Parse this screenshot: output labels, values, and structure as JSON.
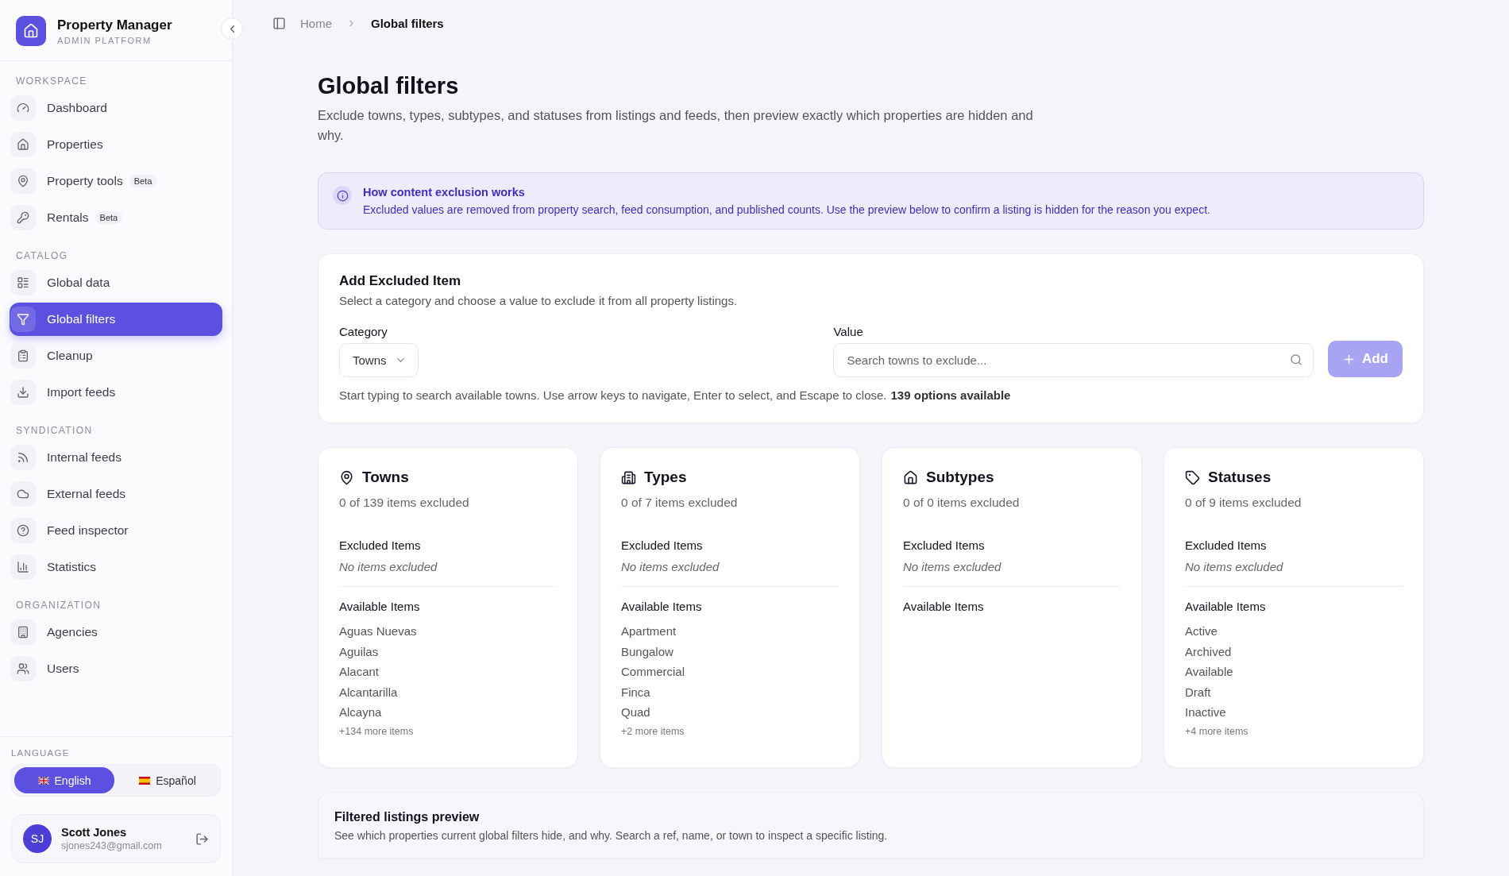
{
  "app": {
    "name": "Property Manager",
    "subtitle": "ADMIN PLATFORM"
  },
  "sidebar": {
    "sections": [
      {
        "label": "WORKSPACE",
        "items": [
          {
            "label": "Dashboard",
            "selected": false
          },
          {
            "label": "Properties",
            "selected": false
          },
          {
            "label": "Property tools",
            "badge": "Beta",
            "selected": false
          },
          {
            "label": "Rentals",
            "badge": "Beta",
            "selected": false
          }
        ]
      },
      {
        "label": "CATALOG",
        "items": [
          {
            "label": "Global data",
            "selected": false
          },
          {
            "label": "Global filters",
            "selected": true
          },
          {
            "label": "Cleanup",
            "selected": false
          },
          {
            "label": "Import feeds",
            "selected": false
          }
        ]
      },
      {
        "label": "SYNDICATION",
        "items": [
          {
            "label": "Internal feeds",
            "selected": false
          },
          {
            "label": "External feeds",
            "selected": false
          },
          {
            "label": "Feed inspector",
            "selected": false
          },
          {
            "label": "Statistics",
            "selected": false
          }
        ]
      },
      {
        "label": "ORGANIZATION",
        "items": [
          {
            "label": "Agencies",
            "selected": false
          },
          {
            "label": "Users",
            "selected": false
          }
        ]
      }
    ]
  },
  "language": {
    "label": "LANGUAGE",
    "options": [
      {
        "label": "English",
        "selected": true
      },
      {
        "label": "Español",
        "selected": false
      }
    ]
  },
  "user": {
    "initials": "SJ",
    "name": "Scott Jones",
    "email": "sjones243@gmail.com"
  },
  "breadcrumb": [
    "Home",
    "Global filters"
  ],
  "page": {
    "title": "Global filters",
    "description": "Exclude towns, types, subtypes, and statuses from listings and feeds, then preview exactly which properties are hidden and why."
  },
  "info": {
    "title": "How content exclusion works",
    "text": "Excluded values are removed from property search, feed consumption, and published counts. Use the preview below to confirm a listing is hidden for the reason you expect."
  },
  "add_form": {
    "title": "Add Excluded Item",
    "description": "Select a category and choose a value to exclude it from all property listings.",
    "category": {
      "label": "Category",
      "value": "Towns"
    },
    "value": {
      "label": "Value",
      "placeholder": "Search towns to exclude..."
    },
    "button": {
      "label": "Add",
      "disabled": true
    },
    "hint": "Start typing to search available towns. Use arrow keys to navigate, Enter to select, and Escape to close.",
    "options_count": "139 options available"
  },
  "cards": [
    {
      "title": "Towns",
      "count": "0 of 139 items excluded",
      "excluded_label": "Excluded Items",
      "excluded_empty": "No items excluded",
      "available_label": "Available Items",
      "items": [
        "Aguas Nuevas",
        "Aguilas",
        "Alacant",
        "Alcantarilla",
        "Alcayna"
      ],
      "more": "+134 more items"
    },
    {
      "title": "Types",
      "count": "0 of 7 items excluded",
      "excluded_label": "Excluded Items",
      "excluded_empty": "No items excluded",
      "available_label": "Available Items",
      "items": [
        "Apartment",
        "Bungalow",
        "Commercial",
        "Finca",
        "Quad"
      ],
      "more": "+2 more items"
    },
    {
      "title": "Subtypes",
      "count": "0 of 0 items excluded",
      "excluded_label": "Excluded Items",
      "excluded_empty": "No items excluded",
      "available_label": "Available Items"
    },
    {
      "title": "Statuses",
      "count": "0 of 9 items excluded",
      "excluded_label": "Excluded Items",
      "excluded_empty": "No items excluded",
      "available_label": "Available Items",
      "items": [
        "Active",
        "Archived",
        "Available",
        "Draft",
        "Inactive"
      ],
      "more": "+4 more items"
    }
  ],
  "preview": {
    "title": "Filtered listings preview",
    "description": "See which properties current global filters hide, and why. Search a ref, name, or town to inspect a specific listing."
  }
}
